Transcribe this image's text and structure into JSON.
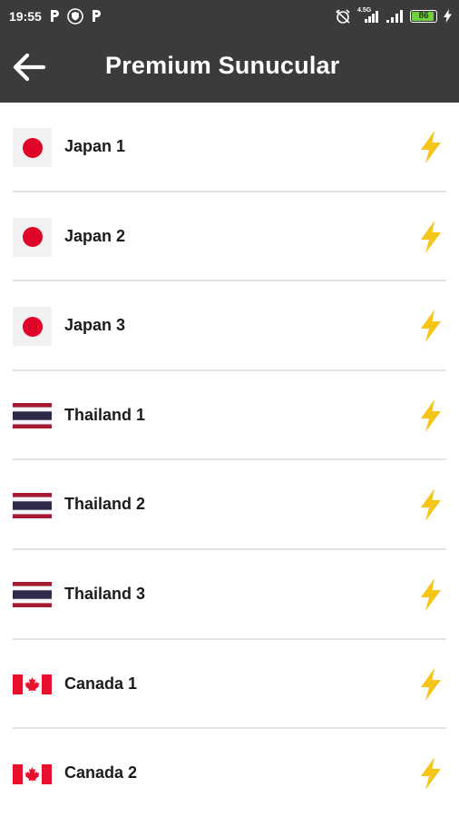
{
  "status_bar": {
    "time": "19:55",
    "left_icons": [
      "p-notification-icon",
      "shield-icon",
      "p-notification-icon"
    ],
    "right_icons": [
      "alarm-off-icon",
      "signal-4g-icon",
      "signal-icon",
      "battery-icon",
      "charging-icon"
    ],
    "network_label": "4.5G",
    "battery_level": "86"
  },
  "app_bar": {
    "back_icon": "arrow-left-icon",
    "title": "Premium Sunucular"
  },
  "colors": {
    "bar_background": "#3b3b3b",
    "bolt": "#f5c518",
    "divider": "#e2e2e2",
    "battery": "#6fcf3f"
  },
  "servers": [
    {
      "name": "Japan 1",
      "flag": "japan-flag-icon",
      "action_icon": "lightning-bolt-icon"
    },
    {
      "name": "Japan 2",
      "flag": "japan-flag-icon",
      "action_icon": "lightning-bolt-icon"
    },
    {
      "name": "Japan 3",
      "flag": "japan-flag-icon",
      "action_icon": "lightning-bolt-icon"
    },
    {
      "name": "Thailand 1",
      "flag": "thailand-flag-icon",
      "action_icon": "lightning-bolt-icon"
    },
    {
      "name": "Thailand 2",
      "flag": "thailand-flag-icon",
      "action_icon": "lightning-bolt-icon"
    },
    {
      "name": "Thailand 3",
      "flag": "thailand-flag-icon",
      "action_icon": "lightning-bolt-icon"
    },
    {
      "name": "Canada 1",
      "flag": "canada-flag-icon",
      "action_icon": "lightning-bolt-icon"
    },
    {
      "name": "Canada 2",
      "flag": "canada-flag-icon",
      "action_icon": "lightning-bolt-icon"
    }
  ]
}
